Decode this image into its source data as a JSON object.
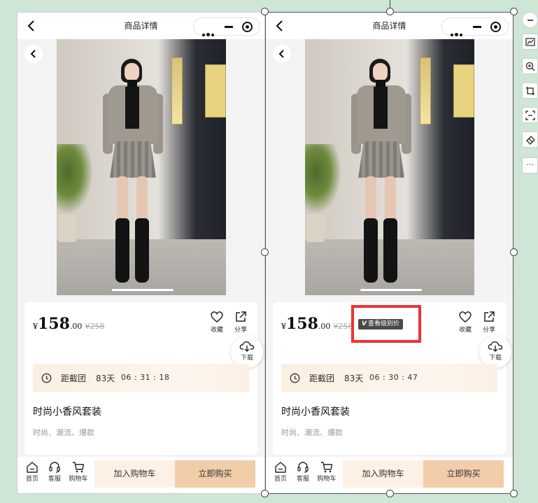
{
  "page_title": "商品详情",
  "product": {
    "currency": "¥",
    "price_int": "158",
    "price_dec": ".00",
    "orig_price": "¥258",
    "vip_label": "查看级别价",
    "vip_badge": "V",
    "name": "时尚小香风套装",
    "tags": "时尚、潮流、爆款",
    "group_label": "距截团",
    "days": "83天"
  },
  "actions": {
    "favorite": "收藏",
    "share": "分享",
    "download": "下载"
  },
  "timers": {
    "left": "06 : 31 : 18",
    "right": "06 : 30 : 47"
  },
  "bottom_nav": {
    "home": "首页",
    "service": "客服",
    "cart": "购物车"
  },
  "buttons": {
    "add_cart": "加入购物车",
    "buy_now": "立即购买"
  },
  "tool_rail": {
    "more": "···"
  },
  "colors": {
    "highlight": "#e33333",
    "buy": "#f1cda9",
    "cart": "#fdf1e6",
    "background": "#cfe5d6"
  }
}
